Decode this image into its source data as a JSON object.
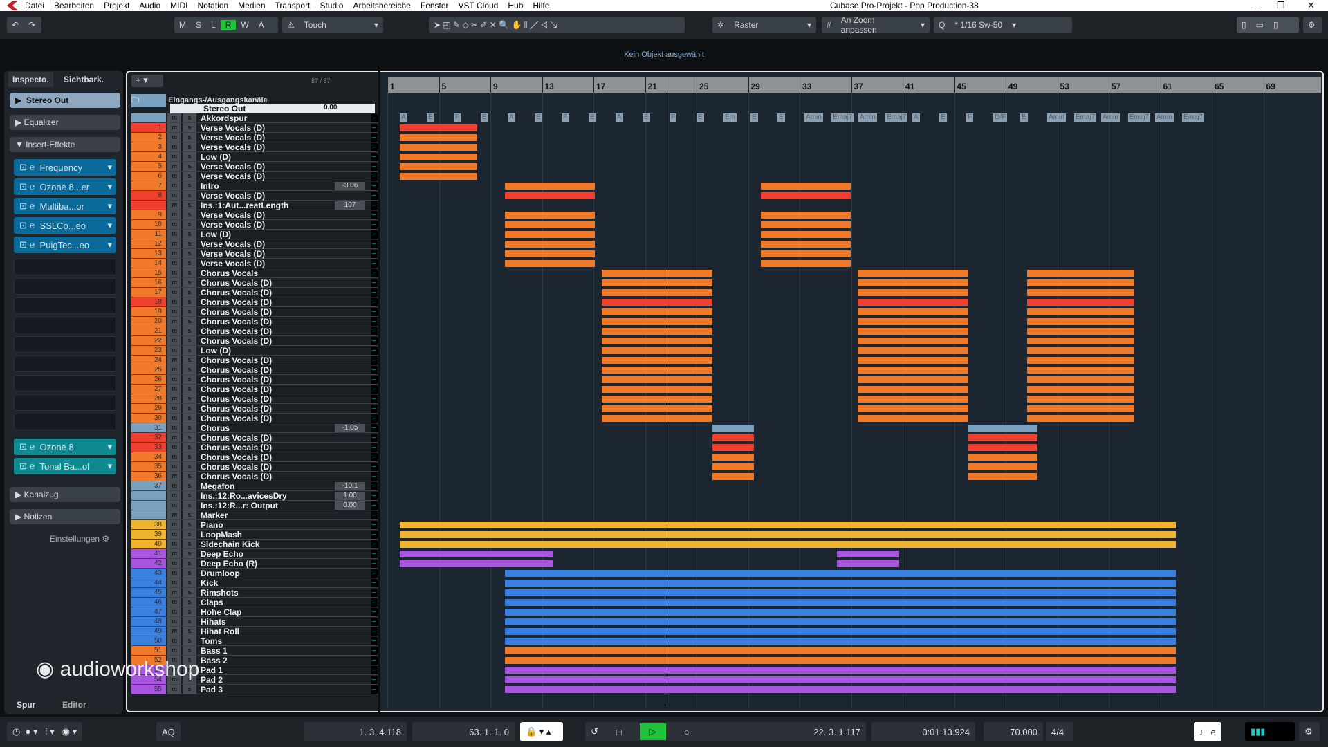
{
  "window": {
    "title": "Cubase Pro-Projekt - Pop Production-38"
  },
  "menu": [
    "Datei",
    "Bearbeiten",
    "Projekt",
    "Audio",
    "MIDI",
    "Notation",
    "Medien",
    "Transport",
    "Studio",
    "Arbeitsbereiche",
    "Fenster",
    "VST Cloud",
    "Hub",
    "Hilfe"
  ],
  "toolbar": {
    "msl": [
      "M",
      "S",
      "L",
      "R",
      "W",
      "A"
    ],
    "automation_mode": "Touch",
    "snap": "Raster",
    "snap_type": "An Zoom anpassen",
    "quantize": "* 1/16  Sw-50"
  },
  "status": "Kein Objekt ausgewählt",
  "inspector": {
    "tabs": [
      "Inspecto.",
      "Sichtbark."
    ],
    "channel": "Stereo Out",
    "sections": [
      "Equalizer",
      "Insert-Effekte",
      "Kanalzug",
      "Notizen"
    ],
    "inserts": [
      "Frequency",
      "Ozone 8...er",
      "Multiba...or",
      "SSLCo...eo",
      "PuigTec...eo"
    ],
    "post_inserts": [
      "Ozone 8",
      "Tonal Ba...ol"
    ],
    "settings": "Einstellungen",
    "bottom_tabs": [
      "Spur",
      "Editor"
    ]
  },
  "tracklist": {
    "count": "87 / 87",
    "folder": "Eingangs-/Ausgangskanäle",
    "stereo_out": {
      "name": "Stereo Out",
      "value": "0.00"
    },
    "tracks": [
      {
        "n": "",
        "name": "Akkordspur",
        "color": "#7aa0c0"
      },
      {
        "n": "1",
        "name": "Verse Vocals (D)",
        "color": "#f04030"
      },
      {
        "n": "2",
        "name": "Verse Vocals (D)",
        "color": "#f07a2a"
      },
      {
        "n": "3",
        "name": "Verse Vocals (D)",
        "color": "#f07a2a"
      },
      {
        "n": "4",
        "name": "Low (D)",
        "color": "#f07a2a"
      },
      {
        "n": "5",
        "name": "Verse Vocals (D)",
        "color": "#f07a2a"
      },
      {
        "n": "6",
        "name": "Verse Vocals (D)",
        "color": "#f07a2a"
      },
      {
        "n": "7",
        "name": "Intro",
        "color": "#f07a2a",
        "value": "-3.06"
      },
      {
        "n": "8",
        "name": "Verse Vocals (D)",
        "color": "#f04030"
      },
      {
        "n": "",
        "name": "Ins.:1:Aut...reatLength",
        "color": "#f04030",
        "value": "107"
      },
      {
        "n": "9",
        "name": "Verse Vocals (D)",
        "color": "#f07a2a"
      },
      {
        "n": "10",
        "name": "Verse Vocals (D)",
        "color": "#f07a2a"
      },
      {
        "n": "11",
        "name": "Low (D)",
        "color": "#f07a2a"
      },
      {
        "n": "12",
        "name": "Verse Vocals (D)",
        "color": "#f07a2a"
      },
      {
        "n": "13",
        "name": "Verse Vocals (D)",
        "color": "#f07a2a"
      },
      {
        "n": "14",
        "name": "Verse Vocals (D)",
        "color": "#f07a2a"
      },
      {
        "n": "15",
        "name": "Chorus Vocals",
        "color": "#f07a2a"
      },
      {
        "n": "16",
        "name": "Chorus Vocals (D)",
        "color": "#f07a2a"
      },
      {
        "n": "17",
        "name": "Chorus Vocals (D)",
        "color": "#f07a2a"
      },
      {
        "n": "18",
        "name": "Chorus Vocals (D)",
        "color": "#f04030"
      },
      {
        "n": "19",
        "name": "Chorus Vocals (D)",
        "color": "#f07a2a"
      },
      {
        "n": "20",
        "name": "Chorus Vocals (D)",
        "color": "#f07a2a"
      },
      {
        "n": "21",
        "name": "Chorus Vocals (D)",
        "color": "#f07a2a"
      },
      {
        "n": "22",
        "name": "Chorus Vocals (D)",
        "color": "#f07a2a"
      },
      {
        "n": "23",
        "name": "Low (D)",
        "color": "#f07a2a"
      },
      {
        "n": "24",
        "name": "Chorus Vocals (D)",
        "color": "#f07a2a"
      },
      {
        "n": "25",
        "name": "Chorus Vocals (D)",
        "color": "#f07a2a"
      },
      {
        "n": "26",
        "name": "Chorus Vocals (D)",
        "color": "#f07a2a"
      },
      {
        "n": "27",
        "name": "Chorus Vocals (D)",
        "color": "#f07a2a"
      },
      {
        "n": "28",
        "name": "Chorus Vocals (D)",
        "color": "#f07a2a"
      },
      {
        "n": "29",
        "name": "Chorus Vocals (D)",
        "color": "#f07a2a"
      },
      {
        "n": "30",
        "name": "Chorus Vocals (D)",
        "color": "#f07a2a"
      },
      {
        "n": "31",
        "name": "Chorus",
        "color": "#7aa0c0",
        "value": "-1.05"
      },
      {
        "n": "32",
        "name": "Chorus Vocals (D)",
        "color": "#f04030"
      },
      {
        "n": "33",
        "name": "Chorus Vocals (D)",
        "color": "#f04030"
      },
      {
        "n": "34",
        "name": "Chorus Vocals (D)",
        "color": "#f07a2a"
      },
      {
        "n": "35",
        "name": "Chorus Vocals (D)",
        "color": "#f07a2a"
      },
      {
        "n": "36",
        "name": "Chorus Vocals (D)",
        "color": "#f07a2a"
      },
      {
        "n": "37",
        "name": "Megafon",
        "color": "#7aa0c0",
        "value": "-10.1"
      },
      {
        "n": "",
        "name": "Ins.:12:Ro...avicesDry",
        "color": "#7aa0c0",
        "value": "1.00"
      },
      {
        "n": "",
        "name": "Ins.:12:R...r: Output",
        "color": "#7aa0c0",
        "value": "0.00"
      },
      {
        "n": "",
        "name": "Marker",
        "color": "#7aa0c0"
      },
      {
        "n": "38",
        "name": "Piano",
        "color": "#f0b430"
      },
      {
        "n": "39",
        "name": "LoopMash",
        "color": "#f0b430"
      },
      {
        "n": "40",
        "name": "Sidechain Kick",
        "color": "#f0b430"
      },
      {
        "n": "41",
        "name": "Deep Echo",
        "color": "#a855e0"
      },
      {
        "n": "42",
        "name": "Deep Echo (R)",
        "color": "#a855e0"
      },
      {
        "n": "43",
        "name": "Drumloop",
        "color": "#3a80e0"
      },
      {
        "n": "44",
        "name": "Kick",
        "color": "#3a80e0"
      },
      {
        "n": "45",
        "name": "Rimshots",
        "color": "#3a80e0"
      },
      {
        "n": "46",
        "name": "Claps",
        "color": "#3a80e0"
      },
      {
        "n": "47",
        "name": "Hohe Clap",
        "color": "#3a80e0"
      },
      {
        "n": "48",
        "name": "Hihats",
        "color": "#3a80e0"
      },
      {
        "n": "49",
        "name": "Hihat Roll",
        "color": "#3a80e0"
      },
      {
        "n": "50",
        "name": "Toms",
        "color": "#3a80e0"
      },
      {
        "n": "51",
        "name": "Bass 1",
        "color": "#f07a2a"
      },
      {
        "n": "52",
        "name": "Bass 2",
        "color": "#f07a2a"
      },
      {
        "n": "53",
        "name": "Pad 1",
        "color": "#a855e0"
      },
      {
        "n": "54",
        "name": "Pad 2",
        "color": "#a855e0"
      },
      {
        "n": "55",
        "name": "Pad 3",
        "color": "#a855e0"
      }
    ]
  },
  "ruler": {
    "bars": [
      "1",
      "5",
      "9",
      "13",
      "17",
      "21",
      "25",
      "29",
      "33",
      "37",
      "41",
      "45",
      "49",
      "53",
      "57",
      "61",
      "65",
      "69"
    ]
  },
  "chords": [
    "A",
    "E",
    "F",
    "E",
    "A",
    "E",
    "F",
    "E",
    "A",
    "E",
    "F",
    "E",
    "Em",
    "E",
    "E",
    "Amin",
    "Emaj7",
    "Amin",
    "Emaj7",
    "A",
    "E",
    "F",
    "D/F",
    "E",
    "Amin",
    "Emaj7",
    "Amin",
    "Emaj7",
    "Amin",
    "Emaj7"
  ],
  "transport": {
    "left_locator": "1. 3. 4.118",
    "right_locator": "63. 1. 1.   0",
    "position_bars": "22. 3. 1.117",
    "position_time": "0:01:13.924",
    "tempo": "70.000",
    "signature": "4/4",
    "aq": "AQ"
  },
  "watermark": "audioworkshop"
}
